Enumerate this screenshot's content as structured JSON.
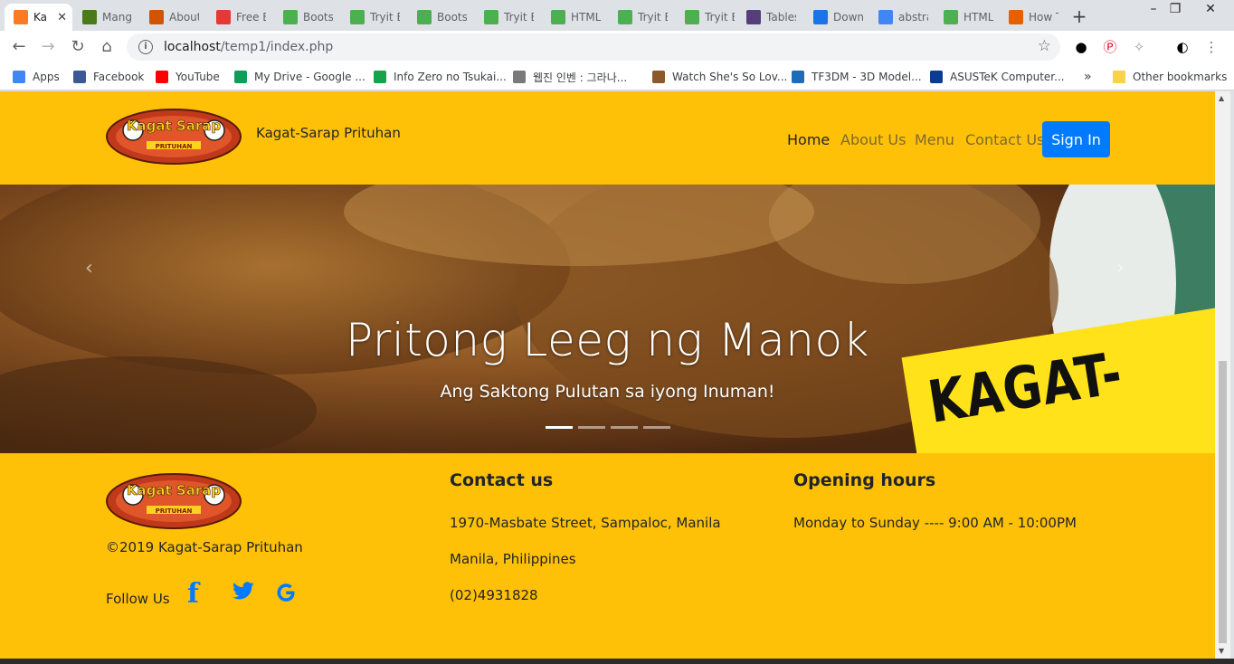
{
  "browser": {
    "tabs": [
      {
        "title": "Ka",
        "icon": "xampp-icon",
        "color": "#fb7a24",
        "active": true
      },
      {
        "title": "Mang",
        "icon": "manga-icon",
        "color": "#4a7a1a"
      },
      {
        "title": "About",
        "icon": "kagat-icon",
        "color": "#d35400"
      },
      {
        "title": "Free E",
        "icon": "s-icon",
        "color": "#e53935"
      },
      {
        "title": "Bootst",
        "icon": "w3-icon",
        "color": "#4caf50"
      },
      {
        "title": "Tryit E",
        "icon": "w3-icon",
        "color": "#4caf50"
      },
      {
        "title": "Bootst",
        "icon": "w3-icon",
        "color": "#4caf50"
      },
      {
        "title": "Tryit E",
        "icon": "w3-icon",
        "color": "#4caf50"
      },
      {
        "title": "HTML",
        "icon": "w3-icon",
        "color": "#4caf50"
      },
      {
        "title": "Tryit E",
        "icon": "w3-icon",
        "color": "#4caf50"
      },
      {
        "title": "Tryit E",
        "icon": "w3-icon",
        "color": "#4caf50"
      },
      {
        "title": "Tables",
        "icon": "bootstrap-icon",
        "color": "#563d7c"
      },
      {
        "title": "Down",
        "icon": "download-icon",
        "color": "#1a73e8"
      },
      {
        "title": "abstra",
        "icon": "google-icon",
        "color": "#4285f4"
      },
      {
        "title": "HTML",
        "icon": "w3-icon",
        "color": "#4caf50"
      },
      {
        "title": "How T",
        "icon": "firefox-icon",
        "color": "#e66000"
      }
    ],
    "url_host": "localhost",
    "url_path": "/temp1/index.php",
    "bookmarks": [
      {
        "label": "Apps",
        "icon": "apps-icon",
        "color": "#4285f4"
      },
      {
        "label": "Facebook",
        "icon": "facebook-icon",
        "color": "#3b5998"
      },
      {
        "label": "YouTube",
        "icon": "youtube-icon",
        "color": "#ff0000"
      },
      {
        "label": "My Drive - Google ...",
        "icon": "drive-icon",
        "color": "#0f9d58"
      },
      {
        "label": "Info Zero no Tsukai...",
        "icon": "v-icon",
        "color": "#16a34a"
      },
      {
        "label": "웹진 인벤 : 그라나...",
        "icon": "inven-icon",
        "color": "#7a7a7a"
      },
      {
        "label": "Watch She's So Lov...",
        "icon": "tv-icon",
        "color": "#8b5a2b"
      },
      {
        "label": "TF3DM - 3D Model...",
        "icon": "3d-icon",
        "color": "#1e6bb8"
      },
      {
        "label": "ASUSTeK Computer...",
        "icon": "asus-icon",
        "color": "#0a3d91"
      }
    ],
    "more_bookmarks": "»",
    "other_bookmarks": "Other bookmarks"
  },
  "site": {
    "brand": "Kagat-Sarap Prituhan",
    "logo_text": "Kagat Sarap",
    "logo_subtext": "PRITUHAN",
    "nav": [
      "Home",
      "About Us",
      "Menu",
      "Contact Us"
    ],
    "signin": "Sign In",
    "slide": {
      "title": "Pritong Leeg ng Manok",
      "subtitle": "Ang Saktong Pulutan sa iyong Inuman!",
      "sticker_text": "KAGAT-",
      "indicators": 4,
      "active_indicator": 0,
      "prev": "‹",
      "next": "›"
    },
    "footer": {
      "copyright": "©2019 Kagat-Sarap Prituhan",
      "follow": "Follow Us",
      "contact_heading": "Contact us",
      "address1": "1970-Masbate Street, Sampaloc, Manila",
      "address2": "Manila, Philippines",
      "phone": "(02)4931828",
      "hours_heading": "Opening hours",
      "hours": "Monday to Sunday ---- 9:00 AM - 10:00PM"
    },
    "colors": {
      "primary": "#ffc107",
      "button": "#007bff"
    }
  }
}
